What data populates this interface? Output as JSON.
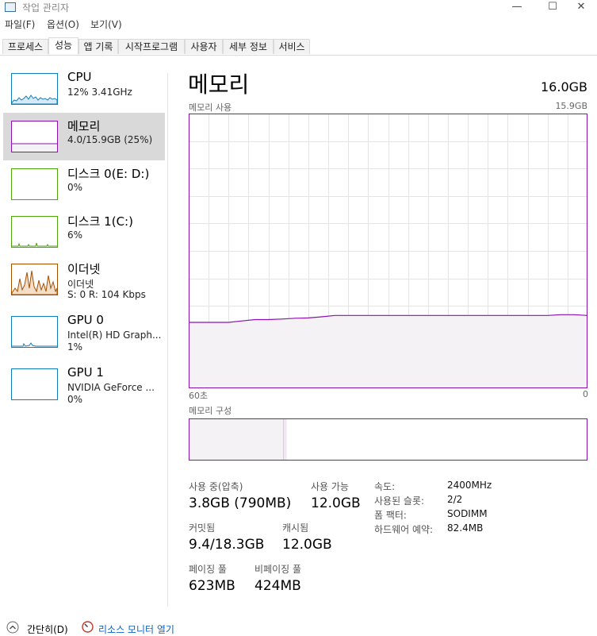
{
  "window": {
    "title": "작업 관리자",
    "minimize": "—",
    "maximize": "☐",
    "close": "✕"
  },
  "menu": [
    "파일(F)",
    "옵션(O)",
    "보기(V)"
  ],
  "tabs": [
    {
      "label": "프로세스",
      "active": false
    },
    {
      "label": "성능",
      "active": true
    },
    {
      "label": "앱 기록",
      "active": false
    },
    {
      "label": "시작프로그램",
      "active": false
    },
    {
      "label": "사용자",
      "active": false
    },
    {
      "label": "세부 정보",
      "active": false
    },
    {
      "label": "서비스",
      "active": false
    }
  ],
  "sidebar": [
    {
      "title": "CPU",
      "sub1": "12% 3.41GHz",
      "sub2": "",
      "color": "#117dbb"
    },
    {
      "title": "메모리",
      "sub1": "4.0/15.9GB (25%)",
      "sub2": "",
      "color": "#8b12ae"
    },
    {
      "title": "디스크 0(E: D:)",
      "sub1": "0%",
      "sub2": "",
      "color": "#4da60c"
    },
    {
      "title": "디스크 1(C:)",
      "sub1": "6%",
      "sub2": "",
      "color": "#4da60c"
    },
    {
      "title": "이더넷",
      "sub1": "이더넷",
      "sub2": "S: 0 R: 104 Kbps",
      "color": "#a74f01"
    },
    {
      "title": "GPU 0",
      "sub1": "Intel(R) HD Graph...",
      "sub2": "1%",
      "color": "#117dbb"
    },
    {
      "title": "GPU 1",
      "sub1": "NVIDIA GeForce ...",
      "sub2": "0%",
      "color": "#117dbb"
    }
  ],
  "main": {
    "title": "메모리",
    "total": "16.0GB",
    "usage_label": "메모리 사용",
    "usage_max": "15.9GB",
    "time_left": "60초",
    "time_right": "0",
    "composition_label": "메모리 구성",
    "composition": {
      "in_use_fraction": 0.238,
      "modified_fraction": 0.008
    },
    "usage_history_fraction": [
      0.24,
      0.24,
      0.24,
      0.24,
      0.245,
      0.25,
      0.25,
      0.252,
      0.255,
      0.256,
      0.26,
      0.265,
      0.265,
      0.265,
      0.265,
      0.265,
      0.265,
      0.265,
      0.265,
      0.265,
      0.265,
      0.265,
      0.265,
      0.265,
      0.265,
      0.265,
      0.265,
      0.265,
      0.268,
      0.268,
      0.265
    ]
  },
  "stats": [
    {
      "label": "사용 중(압축)",
      "value": "3.8GB (790MB)"
    },
    {
      "label": "사용 가능",
      "value": "12.0GB"
    },
    {
      "label": "커밋됨",
      "value": "9.4/18.3GB"
    },
    {
      "label": "캐시됨",
      "value": "12.0GB"
    },
    {
      "label": "페이징 풀",
      "value": "623MB"
    },
    {
      "label": "비페이징 풀",
      "value": "424MB"
    }
  ],
  "specs": [
    {
      "label": "속도:",
      "value": "2400MHz"
    },
    {
      "label": "사용된 슬롯:",
      "value": "2/2"
    },
    {
      "label": "폼 팩터:",
      "value": "SODIMM"
    },
    {
      "label": "하드웨어 예약:",
      "value": "82.4MB"
    }
  ],
  "footer": {
    "fewer_details": "간단히(D)",
    "resource_monitor": "리소스 모니터 열기"
  },
  "colors": {
    "memory": "#8b12ae",
    "memory_fill": "#f4f2f4",
    "grid": "#e4e4e4"
  }
}
